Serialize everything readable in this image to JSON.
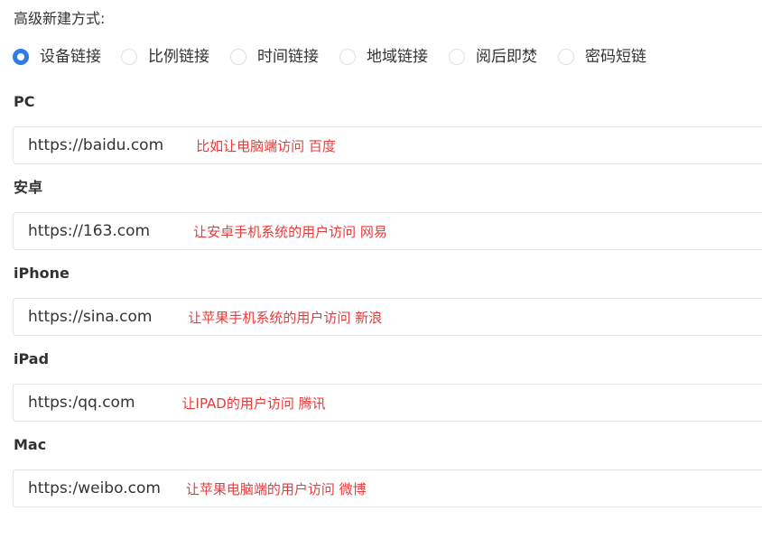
{
  "heading": "高级新建方式:",
  "modes": [
    {
      "label": "设备链接",
      "checked": true
    },
    {
      "label": "比例链接",
      "checked": false
    },
    {
      "label": "时间链接",
      "checked": false
    },
    {
      "label": "地域链接",
      "checked": false
    },
    {
      "label": "阅后即焚",
      "checked": false
    },
    {
      "label": "密码短链",
      "checked": false
    }
  ],
  "fields": [
    {
      "label": "PC",
      "value": "https://baidu.com",
      "note": "比如让电脑端访问 百度"
    },
    {
      "label": "安卓",
      "value": "https://163.com",
      "note": "让安卓手机系统的用户访问 网易"
    },
    {
      "label": "iPhone",
      "value": "https://sina.com",
      "note": "让苹果手机系统的用户访问 新浪"
    },
    {
      "label": "iPad",
      "value": "https:/qq.com",
      "note": "让IPAD的用户访问 腾讯"
    },
    {
      "label": "Mac",
      "value": "https:/weibo.com",
      "note": "让苹果电脑端的用户访问 微博"
    }
  ],
  "colors": {
    "accent": "#2f7bea",
    "note": "#e73b3b"
  }
}
